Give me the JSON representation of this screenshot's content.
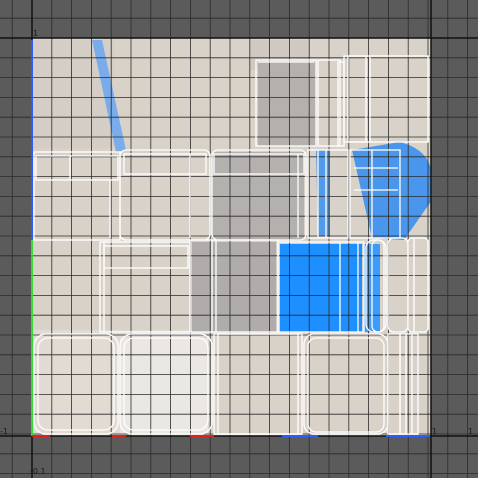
{
  "viewport": {
    "name": "uv-editor",
    "background": "#5b5b5b",
    "uv_area_color": "#d8d1c8",
    "grid_line_color": "#2e2e2e",
    "axis_line_color": "#111111",
    "selected_face_color": "#1e8fff",
    "selection_stroke": "#ffffff"
  },
  "axis_labels": {
    "top_left": "1",
    "bottom_left": "-0.1",
    "left_origin": "-1",
    "right_one": "1",
    "right_edge": "1"
  },
  "islands": [
    {
      "id": "island-top-a",
      "selected": false
    },
    {
      "id": "island-top-b",
      "selected": false
    },
    {
      "id": "island-mid-left-1",
      "selected": false
    },
    {
      "id": "island-mid-left-2",
      "selected": false
    },
    {
      "id": "island-mid-center",
      "selected": false
    },
    {
      "id": "island-mid-right",
      "selected": true
    },
    {
      "id": "island-low-left",
      "selected": false
    },
    {
      "id": "island-low-center",
      "selected": false
    },
    {
      "id": "island-low-blue",
      "selected": true
    },
    {
      "id": "island-low-right",
      "selected": false
    },
    {
      "id": "island-bottom-row",
      "selected": false
    }
  ]
}
